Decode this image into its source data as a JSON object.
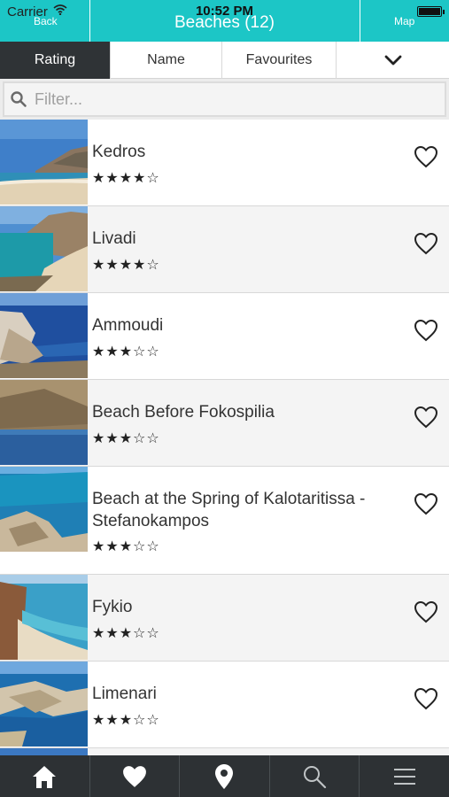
{
  "status_bar": {
    "carrier": "Carrier",
    "time": "10:52 PM"
  },
  "nav": {
    "back_label": "Back",
    "title": "Beaches (12)",
    "map_label": "Map"
  },
  "sort_tabs": [
    {
      "label": "Rating",
      "active": true
    },
    {
      "label": "Name",
      "active": false
    },
    {
      "label": "Favourites",
      "active": false
    }
  ],
  "sort_more_icon": "chevron-down-icon",
  "filter": {
    "placeholder": "Filter...",
    "icon": "search-icon"
  },
  "beaches": [
    {
      "name": "Kedros",
      "stars": "★★★★☆"
    },
    {
      "name": "Livadi",
      "stars": "★★★★☆"
    },
    {
      "name": "Ammoudi",
      "stars": "★★★☆☆"
    },
    {
      "name": "Beach Before Fokospilia",
      "stars": "★★★☆☆"
    },
    {
      "name": "Beach at the Spring of Kalotaritissa - Stefanokampos",
      "stars": "★★★☆☆"
    },
    {
      "name": "Fykio",
      "stars": "★★★☆☆"
    },
    {
      "name": "Limenari",
      "stars": "★★★☆☆"
    }
  ],
  "tabbar": [
    "home-icon",
    "heart-icon",
    "map-pin-icon",
    "search-icon",
    "menu-icon"
  ],
  "colors": {
    "accent": "#1cc6c6",
    "dark": "#2d3134"
  }
}
